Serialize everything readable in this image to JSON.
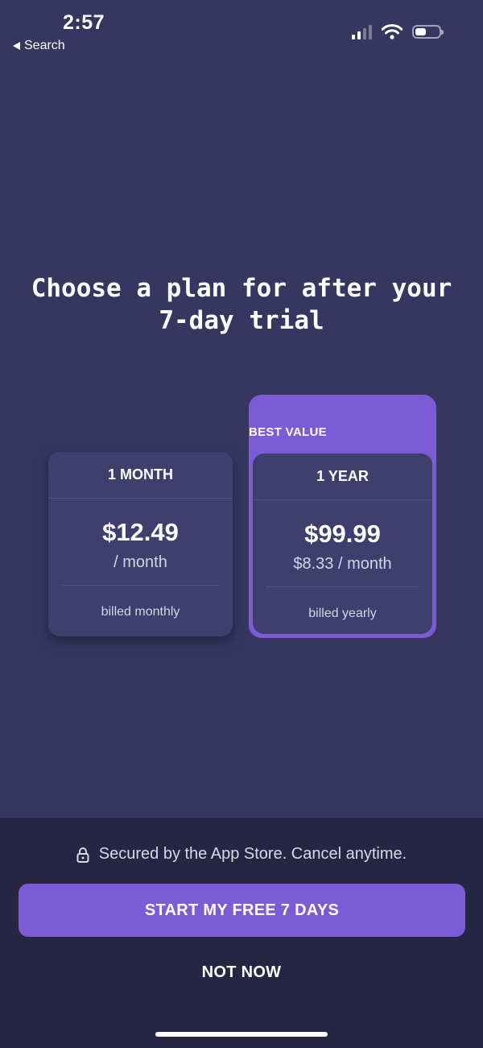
{
  "status_bar": {
    "time": "2:57",
    "back_label": "Search",
    "icons": [
      "signal-icon",
      "wifi-icon",
      "battery-icon"
    ]
  },
  "headline": {
    "line1": "Choose a plan for after your",
    "line2": "7-day trial"
  },
  "plans": [
    {
      "title": "1 MONTH",
      "price": "$12.49",
      "unit": "/ month",
      "billing": "billed monthly",
      "selected": false
    },
    {
      "badge": "BEST VALUE",
      "title": "1 YEAR",
      "price": "$99.99",
      "unit": "$8.33 / month",
      "billing": "billed yearly",
      "selected": true
    }
  ],
  "footer": {
    "secure_text": "Secured by the App Store. Cancel anytime.",
    "cta_label": "START MY FREE 7 DAYS",
    "not_now_label": "NOT NOW"
  },
  "colors": {
    "background": "#363660",
    "card": "#3f3f6e",
    "accent": "#7c5cd6",
    "bottom_panel": "#262644"
  }
}
